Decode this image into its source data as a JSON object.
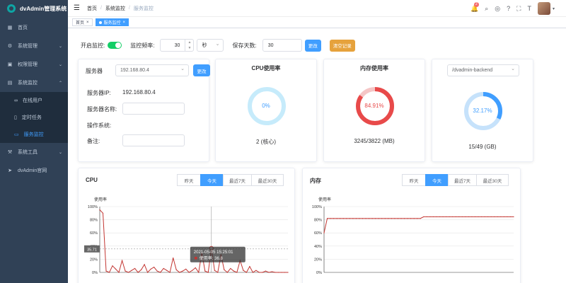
{
  "brand": {
    "title": "dvAdmin管理系统"
  },
  "sidebar": {
    "items": [
      {
        "label": "首页",
        "icon": "dashboard-icon"
      },
      {
        "label": "系统管理",
        "icon": "gear-icon"
      },
      {
        "label": "权限管理",
        "icon": "lock-icon"
      },
      {
        "label": "系统监控",
        "icon": "monitor-icon"
      },
      {
        "label": "系统工具",
        "icon": "tools-icon"
      },
      {
        "label": "dvAdmin官网",
        "icon": "send-icon"
      }
    ],
    "monitor_sub": [
      {
        "label": "在线用户",
        "icon": "link-icon"
      },
      {
        "label": "定时任务",
        "icon": "doc-icon"
      },
      {
        "label": "服务监控",
        "icon": "screen-icon"
      }
    ]
  },
  "header": {
    "breadcrumb": [
      "首页",
      "系统监控",
      "服务监控"
    ],
    "badge": "2"
  },
  "tags": [
    {
      "label": "首页"
    },
    {
      "label": "服务监控"
    }
  ],
  "toolbar": {
    "monitor_label": "开启监控:",
    "monitor_on": true,
    "freq_label": "监控频率:",
    "freq_value": "30",
    "freq_unit": "秒",
    "keep_label": "保存天数:",
    "keep_value": "30",
    "update_btn": "更改",
    "clear_btn": "清空记录"
  },
  "server": {
    "label": "服务器",
    "selected": "192.168.80.4",
    "update_btn": "更改",
    "ip_label": "服务器IP:",
    "ip_value": "192.168.80.4",
    "name_label": "服务器名称:",
    "os_label": "操作系统:",
    "note_label": "备注:"
  },
  "cpu_card": {
    "title": "CPU使用率",
    "percent": "0%",
    "value": 0,
    "detail": "2 (核心)",
    "color": "#87d4f5"
  },
  "mem_card": {
    "title": "内存使用率",
    "percent": "84.91%",
    "value": 84.91,
    "detail": "3245/3822 (MB)",
    "color": "#e84a4a"
  },
  "disk_card": {
    "select": "/dvadmin-backend",
    "percent": "32.17%",
    "value": 32.17,
    "detail": "15/49 (GB)",
    "color": "#409eff"
  },
  "ranges": [
    "昨天",
    "今天",
    "最近7天",
    "最近30天"
  ],
  "chart_data": [
    {
      "type": "line",
      "title": "CPU",
      "ylabel": "使用率",
      "ylim": [
        0,
        100
      ],
      "yticks": [
        "100%",
        "80%",
        "60%",
        "40%",
        "20%",
        "0%"
      ],
      "marker_value": "35.71",
      "tooltip": {
        "time": "2021-05-05 15:25:01",
        "label": "使用率: 36.8"
      },
      "series": [
        {
          "values": [
            95,
            90,
            2,
            0,
            10,
            5,
            0,
            18,
            2,
            0,
            3,
            6,
            0,
            4,
            12,
            0,
            5,
            8,
            2,
            0,
            6,
            3,
            0,
            22,
            4,
            0,
            2,
            5,
            0,
            3,
            7,
            0,
            30,
            2,
            0,
            36.8,
            3,
            0,
            27,
            4,
            0,
            6,
            2,
            0,
            18,
            3,
            0,
            9,
            0,
            3,
            0,
            0,
            2,
            0,
            1,
            0,
            0,
            0,
            0,
            0
          ]
        }
      ],
      "color": "#c23531"
    },
    {
      "type": "line",
      "title": "内存",
      "ylabel": "使用率",
      "ylim": [
        0,
        100
      ],
      "yticks": [
        "100%",
        "80%",
        "60%",
        "40%",
        "20%",
        "0%"
      ],
      "series": [
        {
          "values": [
            60,
            82,
            82,
            82,
            82,
            82,
            82,
            82,
            82,
            82,
            82,
            82,
            82,
            82,
            82,
            82,
            82,
            82,
            82,
            82,
            82,
            82,
            82,
            82,
            82,
            82,
            82,
            82,
            82,
            82,
            82,
            84.5,
            84.5,
            84.5,
            84.5,
            84.5,
            84.5,
            84.5,
            84.5,
            84.5,
            84.5,
            84.5,
            84.5,
            84.5,
            84.5,
            84.5,
            84.5,
            84.5,
            84.5,
            84.5,
            84.5,
            84.5,
            84.5,
            84.5,
            84.5,
            84.5,
            84.5,
            84.5,
            84.5,
            84.5
          ]
        }
      ],
      "color": "#c23531"
    }
  ]
}
